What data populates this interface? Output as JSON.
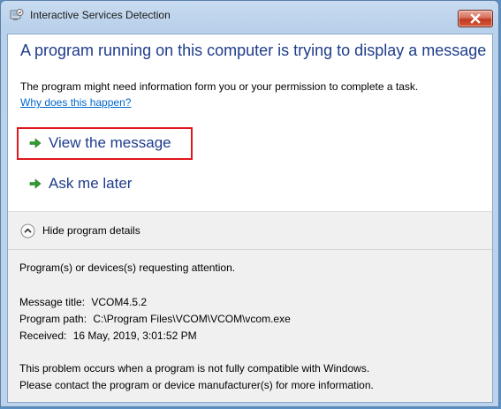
{
  "window": {
    "title": "Interactive Services Detection"
  },
  "main": {
    "heading": "A program running on this computer is trying to display a message",
    "description": "The program might need information form you or your permission to complete a task.",
    "why_link": "Why does this happen?"
  },
  "commands": {
    "view_message": "View the message",
    "ask_later": "Ask me later"
  },
  "details": {
    "toggle_label": "Hide program details",
    "requesting": "Program(s) or devices(s) requesting attention.",
    "message_title_label": "Message title:",
    "message_title_value": "VCOM4.5.2",
    "program_path_label": "Program path:",
    "program_path_value": "C:\\Program Files\\VCOM\\VCOM\\vcom.exe",
    "received_label": "Received:",
    "received_value": "16 May, 2019, 3:01:52 PM",
    "problem_line1": "This problem occurs when a program is not fully compatible with Windows.",
    "problem_line2": "Please contact the program or device manufacturer(s) for more information."
  },
  "colors": {
    "heading": "#1e3c8c",
    "link": "#0066cc",
    "highlight_border": "#e0161c",
    "arrow_green": "#2e9e2e"
  },
  "icons": {
    "title": "interactive-services-icon",
    "close": "close-icon",
    "command_arrow": "green-arrow-icon",
    "details_toggle": "chevron-up-circle-icon"
  }
}
